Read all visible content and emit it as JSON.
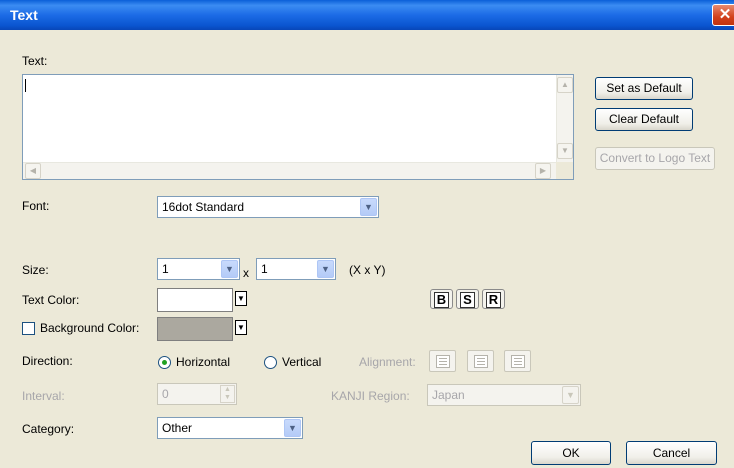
{
  "window": {
    "title": "Text",
    "close_glyph": "✕"
  },
  "text_section": {
    "label": "Text:",
    "value": ""
  },
  "buttons": {
    "set_default": "Set as Default",
    "clear_default": "Clear Default",
    "convert_logo": "Convert to Logo Text",
    "ok": "OK",
    "cancel": "Cancel"
  },
  "font": {
    "label": "Font:",
    "value": "16dot Standard"
  },
  "size": {
    "label": "Size:",
    "x": "1",
    "y": "1",
    "separator": "x",
    "hint": "(X x Y)"
  },
  "text_color": {
    "label": "Text Color:",
    "color": "#ffffff"
  },
  "style_buttons": {
    "bold": "B",
    "shadow": "S",
    "reverse": "R"
  },
  "background_color": {
    "label": "Background Color:",
    "checked": false,
    "color": "#aba89f"
  },
  "direction": {
    "label": "Direction:",
    "options": [
      "Horizontal",
      "Vertical"
    ],
    "selected": "Horizontal"
  },
  "alignment": {
    "label": "Alignment:"
  },
  "interval": {
    "label": "Interval:",
    "value": "0"
  },
  "kanji_region": {
    "label": "KANJI Region:",
    "value": "Japan"
  },
  "category": {
    "label": "Category:",
    "value": "Other"
  },
  "icons": {
    "scroll_up": "▲",
    "scroll_down": "▼",
    "scroll_left": "◀",
    "scroll_right": "▶",
    "dropdown": "▼"
  },
  "colors": {
    "titlebar": "#0a55d0",
    "dialog_bg": "#ece9d8",
    "field_border": "#7f9db9"
  }
}
